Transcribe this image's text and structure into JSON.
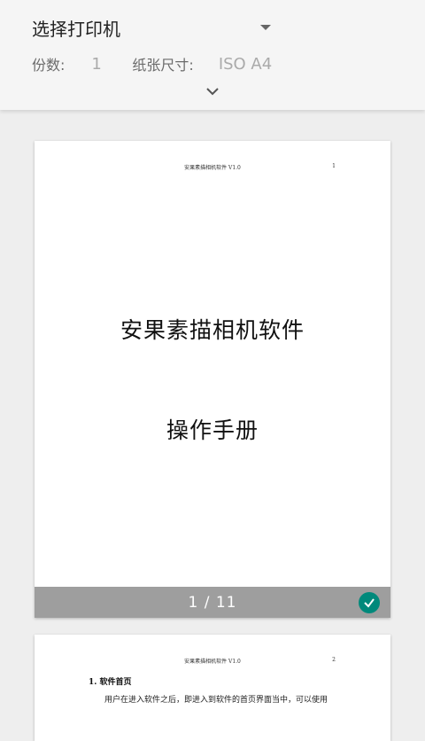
{
  "header": {
    "printer_select": "选择打印机",
    "copies_label": "份数:",
    "copies_value": "1",
    "paper_size_label": "纸张尺寸:",
    "paper_size_value": "ISO A4"
  },
  "pages": [
    {
      "running_header": "安果素描相机软件 V1.0",
      "page_number": "1",
      "title": "安果素描相机软件",
      "subtitle": "操作手册",
      "indicator": "1 / 11",
      "selected": true
    },
    {
      "running_header": "安果素描相机软件 V1.0",
      "page_number": "2",
      "section_heading": "1. 软件首页",
      "body_text": "用户在进入软件之后，即进入到软件的首页界面当中，可以使用"
    }
  ],
  "colors": {
    "accent": "#00897b",
    "footer_bar": "#9e9e9e"
  },
  "icons": [
    "dropdown-arrow-icon",
    "chevron-down-icon",
    "check-icon"
  ]
}
